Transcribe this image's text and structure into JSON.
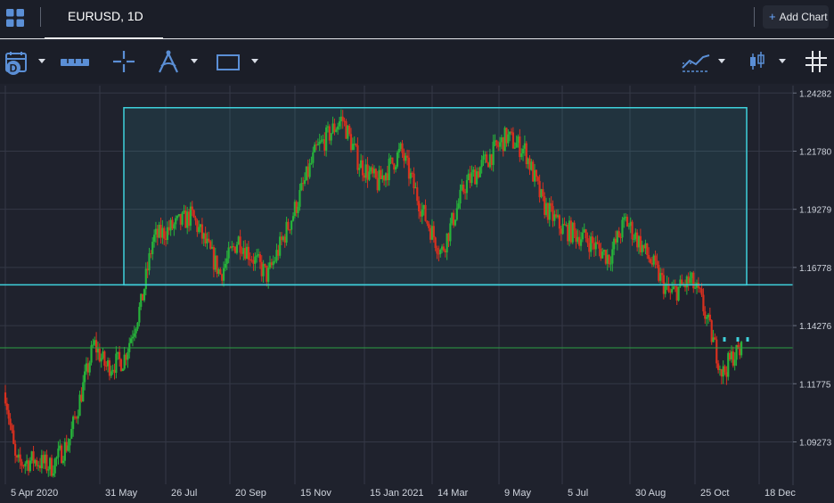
{
  "tabs": {
    "active_title": "EURUSD, 1D"
  },
  "header": {
    "add_chart_label": "Add Chart"
  },
  "toolbar": {
    "icons": [
      "calendar-d-icon",
      "ruler-icon",
      "crosshair-icon",
      "fibonacci-icon",
      "rectangle-icon",
      "indicators-icon",
      "candles-icon",
      "grid-icon"
    ]
  },
  "colors": {
    "background": "#1f222d",
    "grid": "#343846",
    "up_candle": "#27b23a",
    "down_candle": "#d8301f",
    "zone_line": "#3fd1dc",
    "price_line": "#2ea043"
  },
  "chart_data": {
    "type": "candlestick",
    "symbol": "EURUSD",
    "timeframe": "1D",
    "y_ticks": [
      "1.24282",
      "1.21780",
      "1.19279",
      "1.16778",
      "1.14276",
      "1.11775",
      "1.09273"
    ],
    "x_ticks": [
      "5 Apr 2020",
      "31 May",
      "26 Jul",
      "20 Sep",
      "15 Nov",
      "15 Jan 2021",
      "14 Mar",
      "9 May",
      "5 Jul",
      "30 Aug",
      "25 Oct",
      "18 Dec"
    ],
    "ylim": [
      1.0745,
      1.246
    ],
    "rectangle_zone": {
      "top": 1.2365,
      "bottom": 1.16028,
      "start": "5 Jun 2020",
      "end": "6 Nov 2021"
    },
    "horizontal_lines": [
      {
        "price": 1.16028,
        "label": "1.16028"
      },
      {
        "price": 1.13319,
        "label": "1.13319"
      }
    ],
    "close_series": [
      {
        "date": "2020-03-27",
        "close": 1.114
      },
      {
        "date": "2020-04-05",
        "close": 1.083
      },
      {
        "date": "2020-04-20",
        "close": 1.085
      },
      {
        "date": "2020-05-05",
        "close": 1.082
      },
      {
        "date": "2020-05-20",
        "close": 1.093
      },
      {
        "date": "2020-06-10",
        "close": 1.135
      },
      {
        "date": "2020-06-20",
        "close": 1.125
      },
      {
        "date": "2020-07-05",
        "close": 1.128
      },
      {
        "date": "2020-07-20",
        "close": 1.152
      },
      {
        "date": "2020-07-30",
        "close": 1.18
      },
      {
        "date": "2020-08-15",
        "close": 1.185
      },
      {
        "date": "2020-09-01",
        "close": 1.19
      },
      {
        "date": "2020-09-25",
        "close": 1.165
      },
      {
        "date": "2020-10-10",
        "close": 1.18
      },
      {
        "date": "2020-11-04",
        "close": 1.164
      },
      {
        "date": "2020-11-25",
        "close": 1.19
      },
      {
        "date": "2020-12-15",
        "close": 1.218
      },
      {
        "date": "2021-01-06",
        "close": 1.232
      },
      {
        "date": "2021-01-20",
        "close": 1.213
      },
      {
        "date": "2021-02-05",
        "close": 1.204
      },
      {
        "date": "2021-02-25",
        "close": 1.218
      },
      {
        "date": "2021-03-15",
        "close": 1.192
      },
      {
        "date": "2021-03-31",
        "close": 1.174
      },
      {
        "date": "2021-04-20",
        "close": 1.203
      },
      {
        "date": "2021-05-10",
        "close": 1.215
      },
      {
        "date": "2021-05-25",
        "close": 1.224
      },
      {
        "date": "2021-06-10",
        "close": 1.218
      },
      {
        "date": "2021-06-25",
        "close": 1.195
      },
      {
        "date": "2021-07-10",
        "close": 1.185
      },
      {
        "date": "2021-08-01",
        "close": 1.18
      },
      {
        "date": "2021-08-20",
        "close": 1.172
      },
      {
        "date": "2021-09-03",
        "close": 1.188
      },
      {
        "date": "2021-09-25",
        "close": 1.17
      },
      {
        "date": "2021-10-10",
        "close": 1.156
      },
      {
        "date": "2021-10-28",
        "close": 1.162
      },
      {
        "date": "2021-11-05",
        "close": 1.155
      },
      {
        "date": "2021-11-15",
        "close": 1.138
      },
      {
        "date": "2021-11-24",
        "close": 1.122
      },
      {
        "date": "2021-12-03",
        "close": 1.13
      },
      {
        "date": "2021-12-10",
        "close": 1.1319
      }
    ]
  }
}
